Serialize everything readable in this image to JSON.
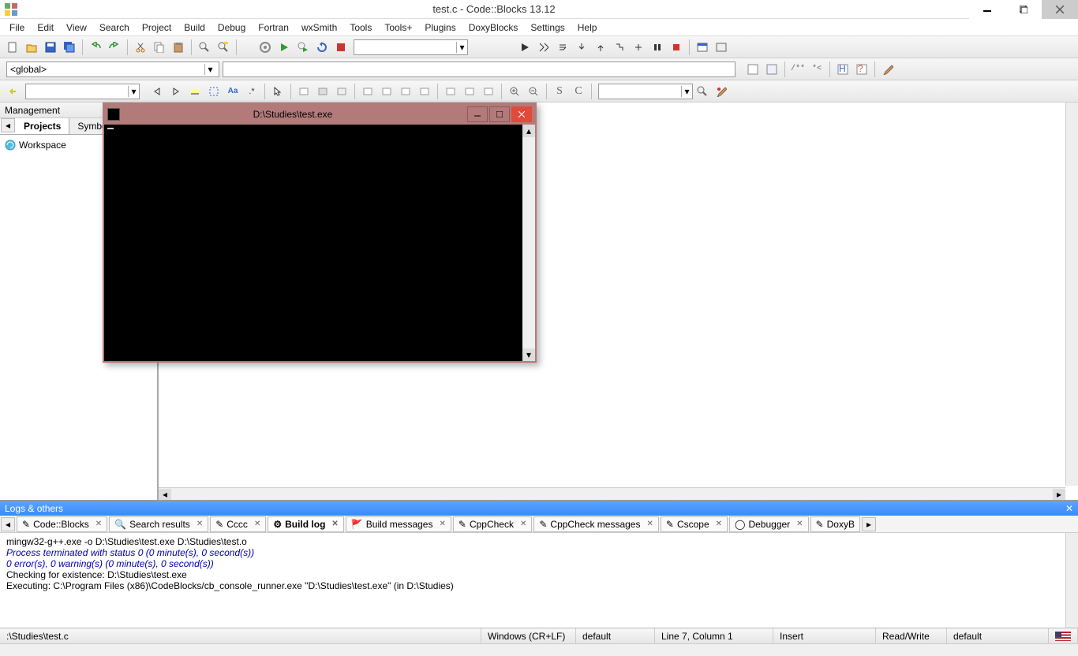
{
  "titlebar": {
    "title": "test.c - Code::Blocks 13.12"
  },
  "menu": [
    "File",
    "Edit",
    "View",
    "Search",
    "Project",
    "Build",
    "Debug",
    "Fortran",
    "wxSmith",
    "Tools",
    "Tools+",
    "Plugins",
    "DoxyBlocks",
    "Settings",
    "Help"
  ],
  "global_combo": "<global>",
  "sidebar": {
    "header": "Management",
    "tabs": [
      {
        "label": "Projects",
        "active": true
      },
      {
        "label": "Symbols",
        "active": false
      }
    ],
    "workspace": "Workspace"
  },
  "console": {
    "title": "D:\\Studies\\test.exe"
  },
  "logs": {
    "header": "Logs & others",
    "tabs": [
      {
        "label": "Code::Blocks",
        "active": false
      },
      {
        "label": "Search results",
        "active": false
      },
      {
        "label": "Cccc",
        "active": false
      },
      {
        "label": "Build log",
        "active": true
      },
      {
        "label": "Build messages",
        "active": false
      },
      {
        "label": "CppCheck",
        "active": false
      },
      {
        "label": "CppCheck messages",
        "active": false
      },
      {
        "label": "Cscope",
        "active": false
      },
      {
        "label": "Debugger",
        "active": false
      },
      {
        "label": "DoxyB",
        "active": false
      }
    ],
    "lines": [
      {
        "text": "mingw32-g++.exe  -o D:\\Studies\\test.exe D:\\Studies\\test.o",
        "cls": ""
      },
      {
        "text": "Process terminated with status 0 (0 minute(s), 0 second(s))",
        "cls": "blue"
      },
      {
        "text": "0 error(s), 0 warning(s) (0 minute(s), 0 second(s))",
        "cls": "blue"
      },
      {
        "text": "",
        "cls": ""
      },
      {
        "text": "Checking for existence: D:\\Studies\\test.exe",
        "cls": ""
      },
      {
        "text": "Executing: C:\\Program Files (x86)\\CodeBlocks/cb_console_runner.exe \"D:\\Studies\\test.exe\" (in D:\\Studies)",
        "cls": ""
      }
    ]
  },
  "status": {
    "file": ":\\Studies\\test.c",
    "eol": "Windows (CR+LF)",
    "enc1": "default",
    "pos": "Line 7, Column 1",
    "ins": "Insert",
    "rw": "Read/Write",
    "enc2": "default"
  }
}
